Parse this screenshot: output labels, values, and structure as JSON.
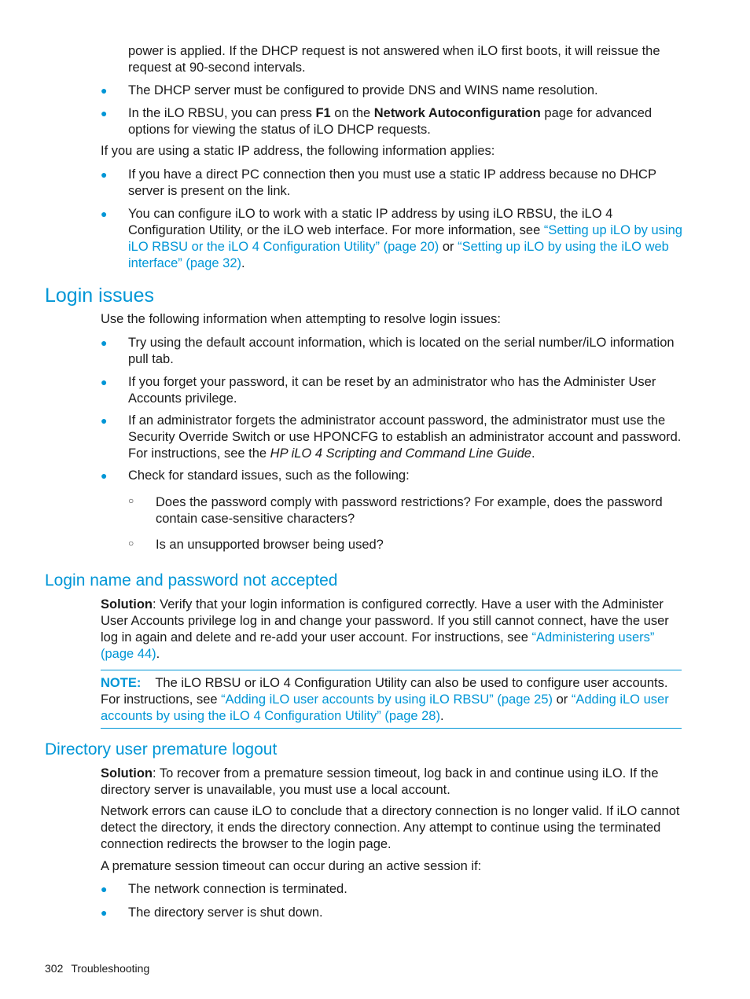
{
  "top": {
    "continued_text": "power is applied. If the DHCP request is not answered when iLO first boots, it will reissue the request at 90-second intervals.",
    "bullets": [
      {
        "text": "The DHCP server must be configured to provide DNS and WINS name resolution."
      },
      {
        "pre": "In the iLO RBSU, you can press ",
        "bold1": "F1",
        "mid": " on the ",
        "bold2": "Network Autoconfiguration",
        "post": " page for advanced options for viewing the status of iLO DHCP requests."
      }
    ],
    "static_intro": "If you are using a static IP address, the following information applies:",
    "static_bullets": [
      {
        "text": "If you have a direct PC connection then you must use a static IP address because no DHCP server is present on the link."
      },
      {
        "pre": "You can configure iLO to work with a static IP address by using iLO RBSU, the iLO 4 Configuration Utility, or the iLO web interface. For more information, see ",
        "link1": "“Setting up iLO by using iLO RBSU or the iLO 4 Configuration Utility” (page 20)",
        "mid": " or ",
        "link2": "“Setting up iLO by using the iLO web interface” (page 32)",
        "post": "."
      }
    ]
  },
  "login_issues": {
    "heading": "Login issues",
    "intro": "Use the following information when attempting to resolve login issues:",
    "bullets": [
      {
        "text": "Try using the default account information, which is located on the serial number/iLO information pull tab."
      },
      {
        "text": "If you forget your password, it can be reset by an administrator who has the Administer User Accounts privilege."
      },
      {
        "pre": "If an administrator forgets the administrator account password, the administrator must use the Security Override Switch or use HPONCFG to establish an administrator account and password. For instructions, see the ",
        "italic": "HP iLO 4 Scripting and Command Line Guide",
        "post": "."
      },
      {
        "text": "Check for standard issues, such as the following:"
      }
    ],
    "sub_bullets": [
      {
        "text": "Does the password comply with password restrictions? For example, does the password contain case-sensitive characters?"
      },
      {
        "text": "Is an unsupported browser being used?"
      }
    ]
  },
  "login_name": {
    "heading": "Login name and password not accepted",
    "solution_label": "Solution",
    "solution_text": ": Verify that your login information is configured correctly. Have a user with the Administer User Accounts privilege log in and change your password. If you still cannot connect, have the user log in again and delete and re-add your user account. For instructions, see ",
    "solution_link": "“Administering users” (page 44)",
    "solution_post": ".",
    "note": {
      "label": "NOTE:",
      "pre": "The iLO RBSU or iLO 4 Configuration Utility can also be used to configure user accounts. For instructions, see ",
      "link1": "“Adding iLO user accounts by using iLO RBSU” (page 25)",
      "mid": " or ",
      "link2": "“Adding iLO user accounts by using the iLO 4 Configuration Utility” (page 28)",
      "post": "."
    }
  },
  "directory": {
    "heading": "Directory user premature logout",
    "solution_label": "Solution",
    "solution_text": ": To recover from a premature session timeout, log back in and continue using iLO. If the directory server is unavailable, you must use a local account.",
    "para2": "Network errors can cause iLO to conclude that a directory connection is no longer valid. If iLO cannot detect the directory, it ends the directory connection. Any attempt to continue using the terminated connection redirects the browser to the login page.",
    "para3": "A premature session timeout can occur during an active session if:",
    "bullets": [
      {
        "text": "The network connection is terminated."
      },
      {
        "text": "The directory server is shut down."
      }
    ]
  },
  "footer": {
    "page_number": "302",
    "section": "Troubleshooting"
  },
  "colors": {
    "accent": "#0096d6",
    "text": "#1a1a1a"
  }
}
